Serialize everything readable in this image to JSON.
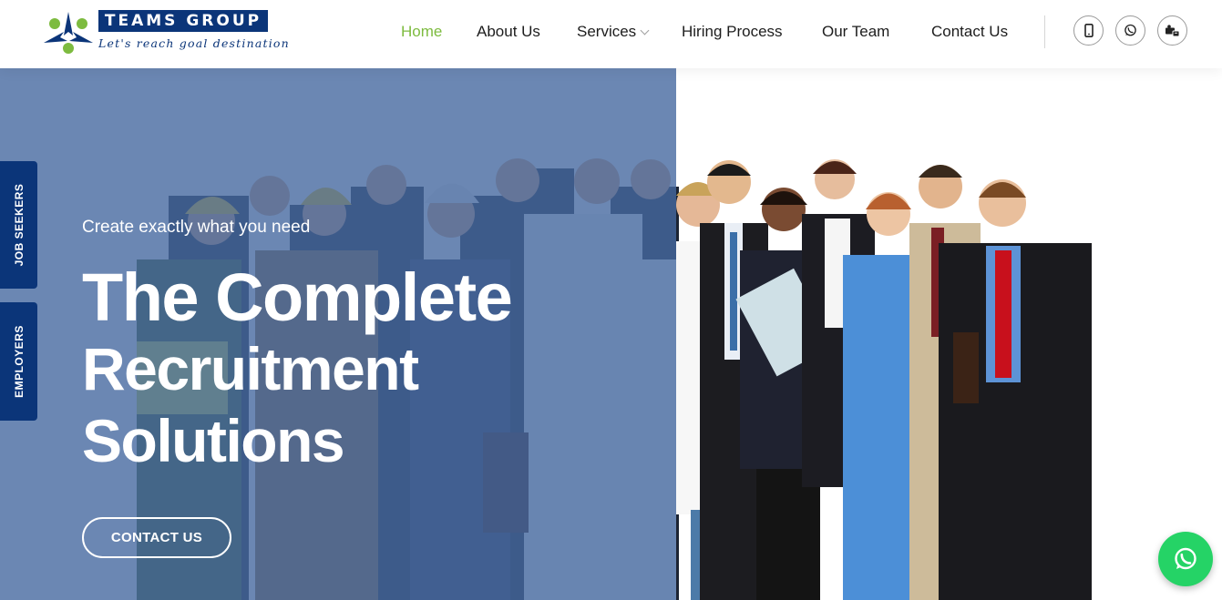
{
  "logo": {
    "name": "TEAMS GROUP",
    "tagline": "Let's reach goal destination"
  },
  "nav": {
    "items": [
      {
        "label": "Home",
        "active": true
      },
      {
        "label": "About Us"
      },
      {
        "label": "Services",
        "has_dropdown": true
      },
      {
        "label": "Hiring Process"
      },
      {
        "label": "Our Team"
      },
      {
        "label": "Contact Us"
      }
    ],
    "icons": [
      "phone-icon",
      "whatsapp-icon",
      "hiring-icon"
    ]
  },
  "side_tabs": [
    "JOB SEEKERS",
    "EMPLOYERS"
  ],
  "hero": {
    "subtitle": "Create exactly what you need",
    "title_lines": [
      "The Complete",
      "Recruitment",
      "Solutions"
    ],
    "cta_label": "CONTACT US"
  },
  "colors": {
    "brand_navy": "#0b3579",
    "accent_green": "#7dbb3f",
    "whatsapp_green": "#25d366",
    "overlay_blue": "#4669a0"
  }
}
